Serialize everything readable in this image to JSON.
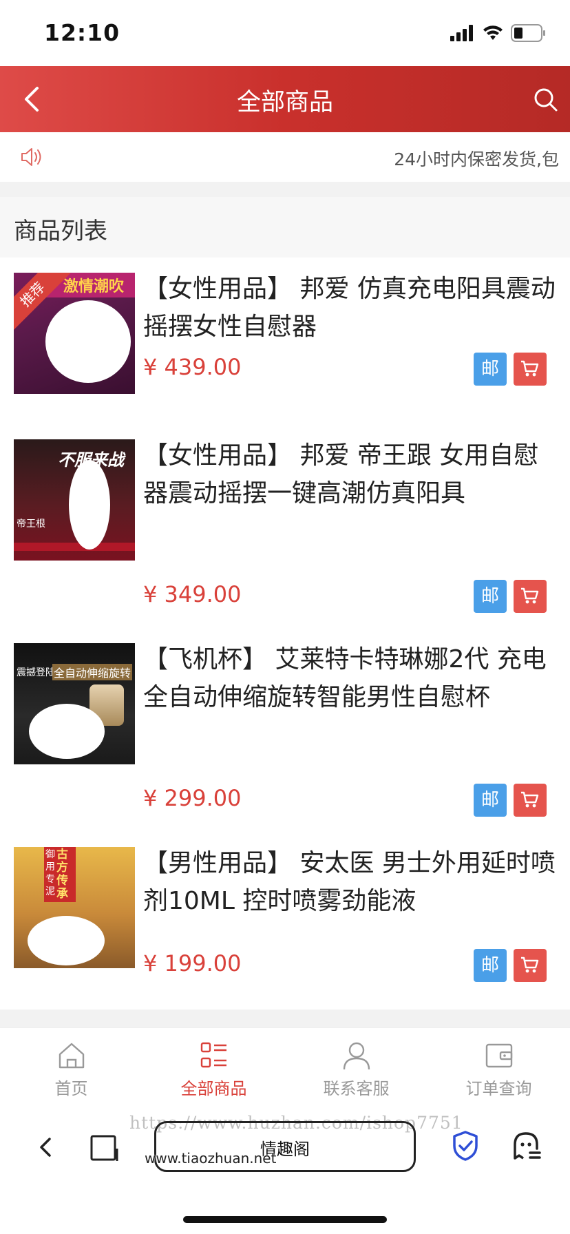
{
  "status_bar": {
    "time": "12:10"
  },
  "header": {
    "title": "全部商品"
  },
  "notice": {
    "text": "24小时内保密发货,包"
  },
  "section": {
    "title": "商品列表"
  },
  "products": [
    {
      "name": "【女性用品】 邦爱 仿真充电阳具震动摇摆女性自慰器",
      "price": "¥ 439.00",
      "mail_label": "邮",
      "badge": "推荐",
      "thumb_text": "激情潮吹"
    },
    {
      "name": "【女性用品】 邦爱 帝王跟 女用自慰器震动摇摆一键高潮仿真阳具",
      "price": "¥ 349.00",
      "mail_label": "邮",
      "thumb_text": "不服来战",
      "thumb_sub": "帝王根"
    },
    {
      "name": "【飞机杯】 艾莱特卡特琳娜2代 充电全自动伸缩旋转智能男性自慰杯",
      "price": "¥ 299.00",
      "mail_label": "邮",
      "thumb_text": "全自动伸缩旋转",
      "thumb_sub": "震撼登陆"
    },
    {
      "name": "【男性用品】 安太医 男士外用延时喷剂10ML 控时喷雾劲能液",
      "price": "¥ 199.00",
      "mail_label": "邮",
      "thumb_text": "古方传承",
      "thumb_sub": "御用专泥"
    }
  ],
  "tabbar": [
    {
      "label": "首页",
      "icon": "home-icon",
      "active": false
    },
    {
      "label": "全部商品",
      "icon": "list-icon",
      "active": true
    },
    {
      "label": "联系客服",
      "icon": "user-icon",
      "active": false
    },
    {
      "label": "订单查询",
      "icon": "wallet-icon",
      "active": false
    }
  ],
  "browser": {
    "address": "情趣阁",
    "watermark_url": "https://www.huzhan.com/ishop7751",
    "watermark_site": "www.tiaozhuan.net"
  },
  "colors": {
    "accent": "#d9413a",
    "header": "#c9302c",
    "mail": "#4a9fe8",
    "cart": "#e5544d"
  }
}
